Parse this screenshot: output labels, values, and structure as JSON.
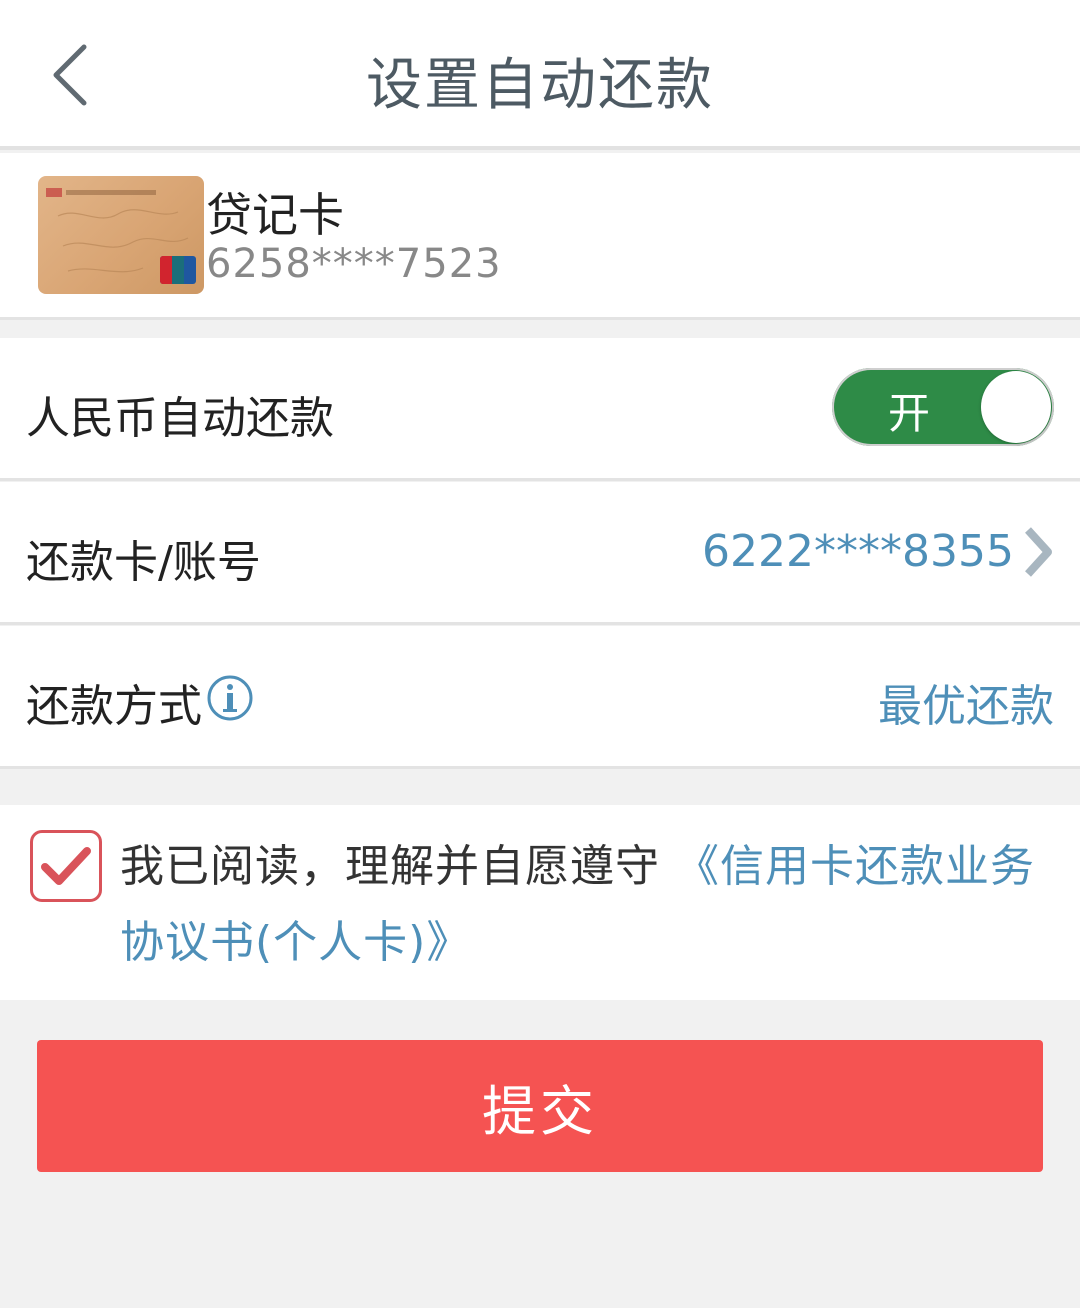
{
  "header": {
    "title": "设置自动还款",
    "back_icon": "chevron-left-icon"
  },
  "card": {
    "name": "贷记卡",
    "number": "6258****7523",
    "image": "icbc-credit-card-image"
  },
  "rows": {
    "rmb_auto": {
      "label": "人民币自动还款",
      "toggle_label": "开",
      "toggle_on": true,
      "toggle_color": "#2e8b47"
    },
    "repay_card": {
      "label": "还款卡/账号",
      "value": "6222****8355",
      "chevron_icon": "chevron-right-icon"
    },
    "repay_method": {
      "label": "还款方式",
      "info_icon": "info-icon",
      "value": "最优还款"
    }
  },
  "agreement": {
    "checked": true,
    "text": "我已阅读，理解并自愿遵守",
    "link_text": "《信用卡还款业务协议书(个人卡)》"
  },
  "submit": {
    "label": "提交",
    "color": "#f55352"
  },
  "colors": {
    "accent_blue": "#4e8fb8",
    "checkbox_red": "#d9535a"
  }
}
